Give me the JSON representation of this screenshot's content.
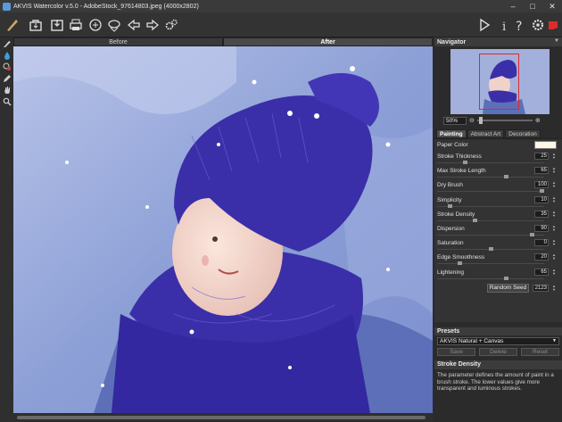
{
  "window": {
    "title": "AKVIS Watercolor v.5.0 - AdobeStock_97614803.jpeg (4000x2802)"
  },
  "toolbar": {
    "left_icons": [
      "open-icon",
      "save-icon",
      "print-icon",
      "share-icon",
      "batch-icon",
      "undo-icon",
      "redo-icon",
      "settings-gears-icon"
    ],
    "right_icons": [
      "run-icon",
      "info-icon",
      "help-icon",
      "preferences-icon",
      "akvis-logo-icon"
    ]
  },
  "view_tabs": {
    "before": "Before",
    "after": "After",
    "active": "after"
  },
  "tools": [
    "brush-icon",
    "drop-icon",
    "stamp-icon",
    "pencil-icon",
    "hand-icon",
    "zoom-icon"
  ],
  "navigator": {
    "title": "Navigator",
    "zoom": "50%"
  },
  "settings_tabs": [
    {
      "label": "Painting",
      "active": true
    },
    {
      "label": "Abstract Art",
      "active": false
    },
    {
      "label": "Decoration",
      "active": false
    }
  ],
  "params": {
    "paper_color": {
      "label": "Paper Color",
      "color": "#fdf7e6"
    },
    "items": [
      {
        "label": "Stroke Thickness",
        "value": "25",
        "level": 0.25
      },
      {
        "label": "Max Stroke Length",
        "value": "65",
        "level": 0.65
      },
      {
        "label": "Dry Brush",
        "value": "100",
        "level": 1.0
      },
      {
        "label": "Simplicity",
        "value": "10",
        "level": 0.1
      },
      {
        "label": "Stroke Density",
        "value": "35",
        "level": 0.35
      },
      {
        "label": "Dispersion",
        "value": "90",
        "level": 0.9
      },
      {
        "label": "Saturation",
        "value": "0",
        "level": 0.5
      },
      {
        "label": "Edge Smoothness",
        "value": "20",
        "level": 0.2
      },
      {
        "label": "Lightening",
        "value": "65",
        "level": 0.65
      }
    ],
    "random_seed_label": "Random Seed",
    "random_seed_value": "2123"
  },
  "presets": {
    "title": "Presets",
    "selected": "AKVIS Natural + Canvas",
    "save": "Save",
    "delete": "Delete",
    "reset": "Reset"
  },
  "hint": {
    "title": "Stroke Density",
    "text": "The parameter defines the amount of paint in a brush stroke. The lower values give more transparent and luminous strokes."
  },
  "colors": {
    "accent_red": "#e02a2a",
    "hat_blue": "#3a2fa8",
    "background": "#8fa3d6"
  }
}
